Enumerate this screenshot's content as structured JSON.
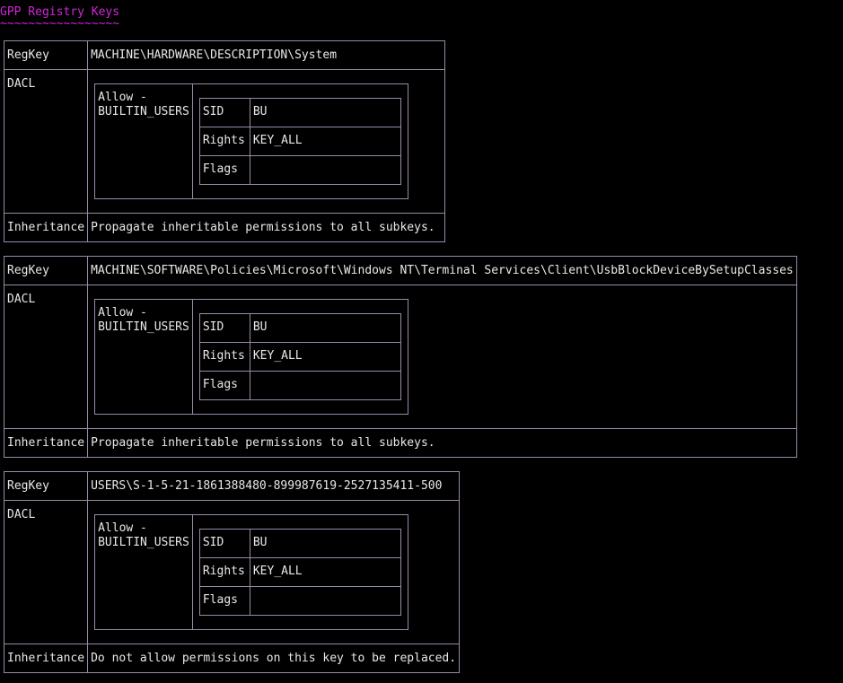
{
  "header": {
    "title": "GPP Registry Keys",
    "underline": "~~~~~~~~~~~~~~~~~"
  },
  "labels": {
    "regkey": "RegKey",
    "dacl": "DACL",
    "inheritance": "Inheritance",
    "sid": "SID",
    "rights": "Rights",
    "flags": "Flags"
  },
  "entries": [
    {
      "regkey": "MACHINE\\HARDWARE\\DESCRIPTION\\System",
      "ace_title": "Allow -\nBUILTIN_USERS",
      "sid": "BU",
      "rights": "KEY_ALL",
      "flags": "",
      "inheritance": "Propagate inheritable permissions to all subkeys."
    },
    {
      "regkey": "MACHINE\\SOFTWARE\\Policies\\Microsoft\\Windows NT\\Terminal Services\\Client\\UsbBlockDeviceBySetupClasses",
      "ace_title": "Allow -\nBUILTIN_USERS",
      "sid": "BU",
      "rights": "KEY_ALL",
      "flags": "",
      "inheritance": "Propagate inheritable permissions to all subkeys."
    },
    {
      "regkey": "USERS\\S-1-5-21-1861388480-899987619-2527135411-500",
      "ace_title": "Allow -\nBUILTIN_USERS",
      "sid": "BU",
      "rights": "KEY_ALL",
      "flags": "",
      "inheritance": "Do not allow permissions on this key to be replaced."
    }
  ]
}
